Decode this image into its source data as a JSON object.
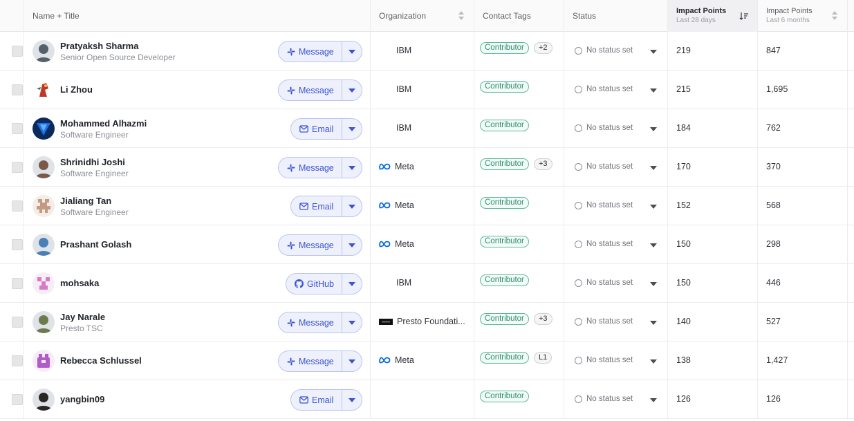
{
  "columns": {
    "name_title": "Name + Title",
    "organization": "Organization",
    "contact_tags": "Contact Tags",
    "status": "Status",
    "impact_28_title": "Impact Points",
    "impact_28_sub": "Last 28 days",
    "impact_6m_title": "Impact Points",
    "impact_6m_sub": "Last 6 months"
  },
  "status_default": "No status set",
  "rows": [
    {
      "name": "Pratyaksh Sharma",
      "title": "Senior Open Source Developer",
      "action": "Message",
      "action_icon": "slack-icon",
      "org": "IBM",
      "org_logo": "",
      "tag": "Contributor",
      "extra": "+2",
      "impact28": "219",
      "impact6m": "847",
      "avatar_color": "#56606b"
    },
    {
      "name": "Li Zhou",
      "title": "",
      "action": "Message",
      "action_icon": "slack-icon",
      "org": "IBM",
      "org_logo": "",
      "tag": "Contributor",
      "extra": "",
      "impact28": "215",
      "impact6m": "1,695",
      "avatar_color": "#c1362b"
    },
    {
      "name": "Mohammed Alhazmi",
      "title": "Software Engineer",
      "action": "Email",
      "action_icon": "mail-icon",
      "org": "IBM",
      "org_logo": "",
      "tag": "Contributor",
      "extra": "",
      "impact28": "184",
      "impact6m": "762",
      "avatar_color": "#0b2a5c"
    },
    {
      "name": "Shrinidhi Joshi",
      "title": "Software Engineer",
      "action": "Message",
      "action_icon": "slack-icon",
      "org": "Meta",
      "org_logo": "meta-logo-icon",
      "tag": "Contributor",
      "extra": "+3",
      "impact28": "170",
      "impact6m": "370",
      "avatar_color": "#7a5a46"
    },
    {
      "name": "Jialiang Tan",
      "title": "Software Engineer",
      "action": "Email",
      "action_icon": "mail-icon",
      "org": "Meta",
      "org_logo": "meta-logo-icon",
      "tag": "Contributor",
      "extra": "",
      "impact28": "152",
      "impact6m": "568",
      "avatar_color": "#c59a82"
    },
    {
      "name": "Prashant Golash",
      "title": "",
      "action": "Message",
      "action_icon": "slack-icon",
      "org": "Meta",
      "org_logo": "meta-logo-icon",
      "tag": "Contributor",
      "extra": "",
      "impact28": "150",
      "impact6m": "298",
      "avatar_color": "#4a7fb8"
    },
    {
      "name": "mohsaka",
      "title": "",
      "action": "GitHub",
      "action_icon": "github-icon",
      "org": "IBM",
      "org_logo": "",
      "tag": "Contributor",
      "extra": "",
      "impact28": "150",
      "impact6m": "446",
      "avatar_color": "#d67ac8"
    },
    {
      "name": "Jay Narale",
      "title": "Presto TSC",
      "action": "Message",
      "action_icon": "slack-icon",
      "org": "Presto Foundati...",
      "org_logo": "presto-logo-icon",
      "tag": "Contributor",
      "extra": "+3",
      "impact28": "140",
      "impact6m": "527",
      "avatar_color": "#6d7a4c"
    },
    {
      "name": "Rebecca Schlussel",
      "title": "",
      "action": "Message",
      "action_icon": "slack-icon",
      "org": "Meta",
      "org_logo": "meta-logo-icon",
      "tag": "Contributor",
      "extra": "L1",
      "impact28": "138",
      "impact6m": "1,427",
      "avatar_color": "#b35ac9"
    },
    {
      "name": "yangbin09",
      "title": "",
      "action": "Email",
      "action_icon": "mail-icon",
      "org": "",
      "org_logo": "",
      "tag": "Contributor",
      "extra": "",
      "impact28": "126",
      "impact6m": "126",
      "avatar_color": "#2a2624"
    }
  ]
}
